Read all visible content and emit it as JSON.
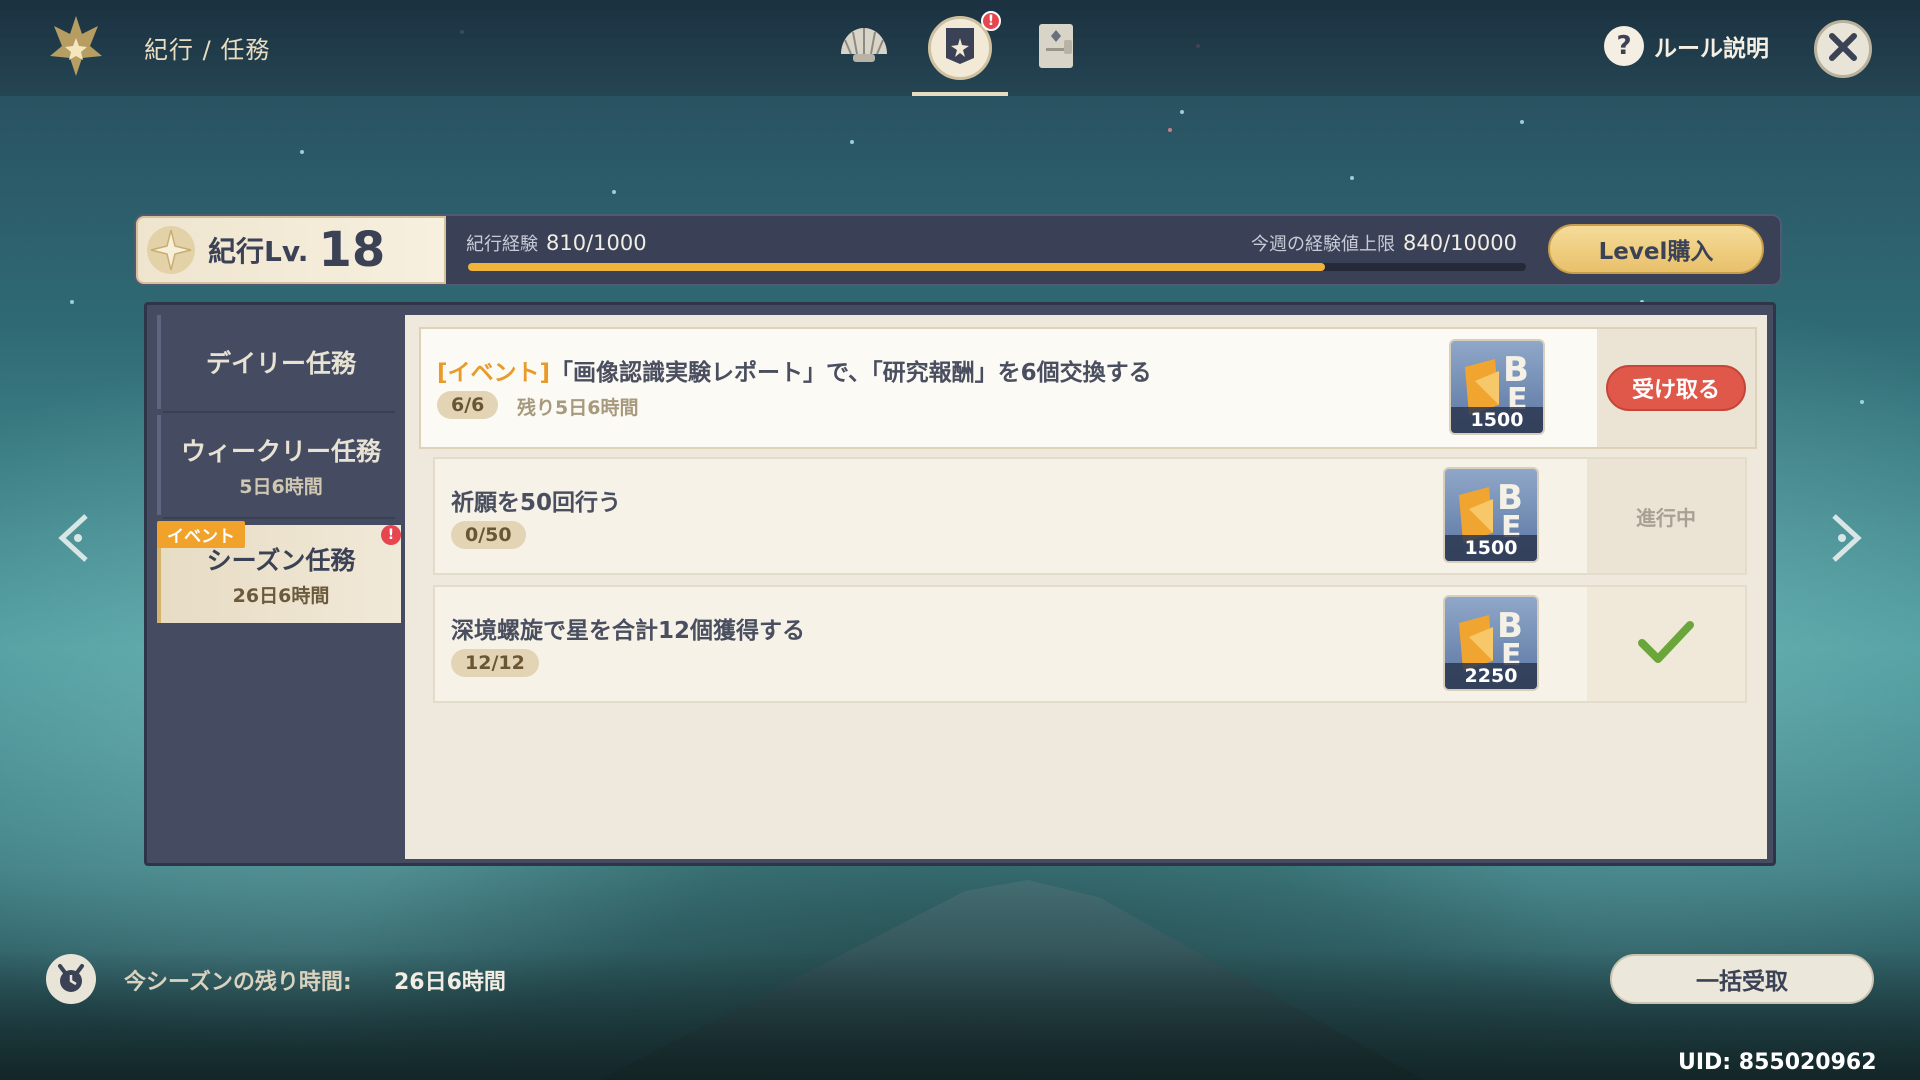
{
  "header": {
    "breadcrumb": "紀行 / 任務",
    "tabs": [
      {
        "icon": "shell-icon",
        "active": false
      },
      {
        "icon": "mission-banner-icon",
        "active": true,
        "badge": "!"
      },
      {
        "icon": "card-icon",
        "active": false
      }
    ],
    "rules_label": "ルール説明"
  },
  "level": {
    "label": "紀行Lv.",
    "value": "18",
    "exp_label": "紀行経験",
    "exp_value": "810/1000",
    "exp_progress": 0.81,
    "weekly_label": "今週の経験値上限",
    "weekly_value": "840/10000",
    "buy_label": "Level購入"
  },
  "sidebar": {
    "items": [
      {
        "title": "デイリー任務",
        "sub": ""
      },
      {
        "title": "ウィークリー任務",
        "sub": "5日6時間"
      },
      {
        "title": "シーズン任務",
        "sub": "26日6時間",
        "tag": "イベント",
        "badge": "!"
      }
    ]
  },
  "tasks": [
    {
      "tag": "[イベント]",
      "title": "「画像認識実験レポート」で、「研究報酬」を6個交換する",
      "progress": "6/6",
      "remaining": "残り5日6時間",
      "reward_count": "1500",
      "action": "受け取る"
    },
    {
      "title": "祈願を50回行う",
      "progress": "0/50",
      "reward_count": "1500",
      "status": "進行中"
    },
    {
      "title": "深境螺旋で星を合計12個獲得する",
      "progress": "12/12",
      "reward_count": "2250",
      "status": "completed"
    }
  ],
  "footer": {
    "season_label": "今シーズンの残り時間:",
    "season_value": "26日6時間",
    "claim_all_label": "一括受取",
    "uid": "UID: 855020962"
  },
  "colors": {
    "accent_gold": "#f0b43a",
    "claim_red": "#e0584a",
    "event_orange": "#e89a2a",
    "check_green": "#6aa63a"
  }
}
